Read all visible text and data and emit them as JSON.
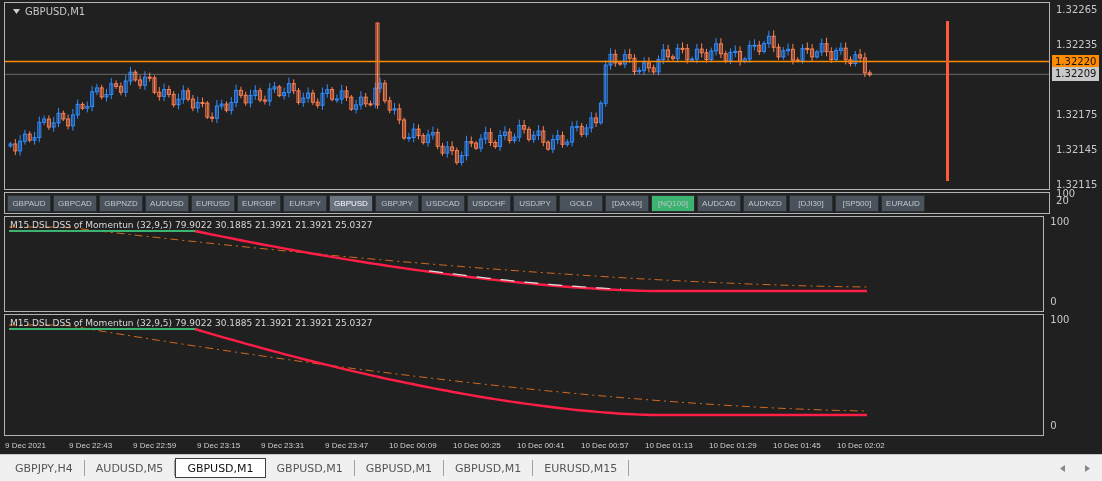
{
  "chart": {
    "title": "GBPUSD,M1",
    "price_ticks": [
      "1.32265",
      "1.32235",
      "1.32175",
      "1.32145",
      "1.32115"
    ],
    "price_tags": [
      {
        "label": "1.32220",
        "color": "#ff8c00"
      },
      {
        "label": "1.32209",
        "color": "#c8c8c8"
      }
    ]
  },
  "symbol_buttons": [
    {
      "label": "GBPAUD",
      "selected": false
    },
    {
      "label": "GBPCAD",
      "selected": false
    },
    {
      "label": "GBPNZD",
      "selected": false
    },
    {
      "label": "AUDUSD",
      "selected": false
    },
    {
      "label": "EURUSD",
      "selected": false
    },
    {
      "label": "EURGBP",
      "selected": false
    },
    {
      "label": "EURJPY",
      "selected": false
    },
    {
      "label": "GBPUSD",
      "selected": true
    },
    {
      "label": "GBPJPY",
      "selected": false
    },
    {
      "label": "USDCAD",
      "selected": false
    },
    {
      "label": "USDCHF",
      "selected": false
    },
    {
      "label": "USDJPY",
      "selected": false
    },
    {
      "label": "GOLD",
      "selected": false
    },
    {
      "label": "[DAX40]",
      "selected": false
    },
    {
      "label": "[NQ100]",
      "selected": false,
      "color": "#3cb371"
    },
    {
      "label": "AUDCAD",
      "selected": false
    },
    {
      "label": "AUDNZD",
      "selected": false
    },
    {
      "label": "[DJI30]",
      "selected": false
    },
    {
      "label": "[SP500]",
      "selected": false
    },
    {
      "label": "EURAUD",
      "selected": false
    }
  ],
  "button_bar_axis": [
    "100",
    "20"
  ],
  "indicators": [
    {
      "label": "M15 DSL DSS of Momentun (32,9,5) 79.9022 30.1885 21.3921 21.3921 25.0327",
      "axis": [
        "100",
        "0"
      ]
    },
    {
      "label": "M15 DSL DSS of Momentun (32,9,5) 79.9022 30.1885 21.3921 21.3921 25.0327",
      "axis": [
        "100",
        "0"
      ]
    }
  ],
  "time_axis": [
    "9 Dec 2021",
    "9 Dec 22:43",
    "9 Dec 22:59",
    "9 Dec 23:15",
    "9 Dec 23:31",
    "9 Dec 23:47",
    "10 Dec 00:09",
    "10 Dec 00:25",
    "10 Dec 00:41",
    "10 Dec 00:57",
    "10 Dec 01:13",
    "10 Dec 01:29",
    "10 Dec 01:45",
    "10 Dec 02:02"
  ],
  "tabs": [
    {
      "label": "GBPJPY,H4",
      "selected": false
    },
    {
      "label": "AUDUSD,M5",
      "selected": false
    },
    {
      "label": "GBPUSD,M1",
      "selected": true
    },
    {
      "label": "GBPUSD,M1",
      "selected": false
    },
    {
      "label": "GBPUSD,M1",
      "selected": false
    },
    {
      "label": "GBPUSD,M1",
      "selected": false
    },
    {
      "label": "EURUSD,M15",
      "selected": false
    }
  ]
}
